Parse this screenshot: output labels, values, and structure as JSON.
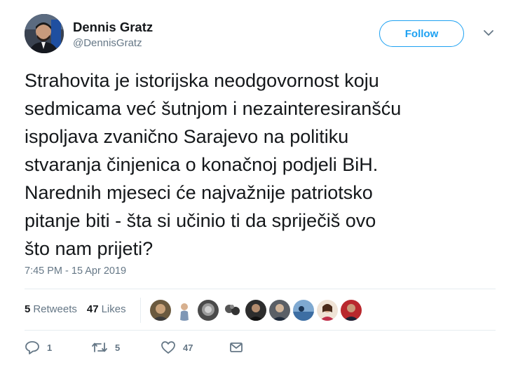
{
  "author": {
    "name": "Dennis Gratz",
    "handle": "@DennisGratz"
  },
  "follow_label": "Follow",
  "tweet": {
    "text": "Strahovita je istorijska neodgovornost koju\nsedmicama već  šutnjom i nezainteresiranšću\nispoljava zvanično Sarajevo na politiku\nstvaranja činjenica o konačnoj podjeli BiH.\nNarednih mjeseci će najvažnije patriotsko\npitanje biti - šta si učinio ti da spriječiš ovo\nšto nam prijeti?",
    "timestamp": "7:45 PM - 15 Apr 2019"
  },
  "stats": {
    "retweets_count": "5",
    "retweets_label": "Retweets",
    "likes_count": "47",
    "likes_label": "Likes"
  },
  "actions": {
    "reply_count": "1",
    "retweet_count": "5",
    "like_count": "47"
  },
  "colors": {
    "accent": "#1da1f2",
    "text": "#14171a",
    "secondary": "#657786",
    "divider": "#e6ecf0"
  },
  "icons": [
    "chevron-down-icon",
    "reply-icon",
    "retweet-icon",
    "heart-icon",
    "message-icon"
  ]
}
